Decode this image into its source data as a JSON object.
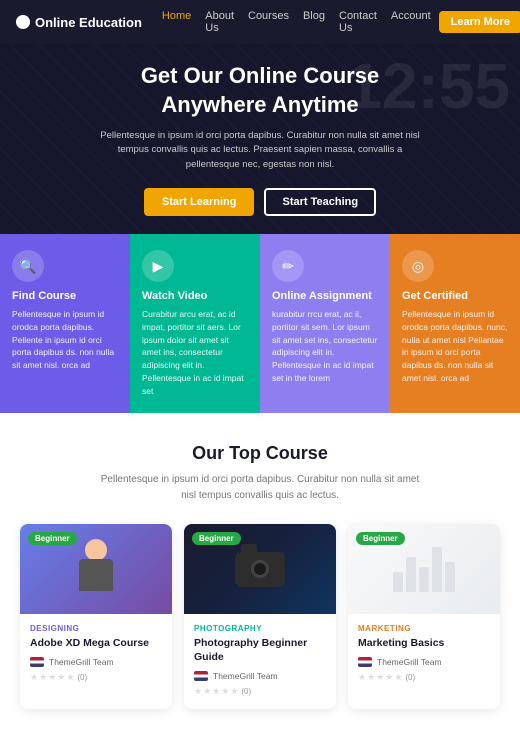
{
  "brand": {
    "name": "Online Education"
  },
  "nav": {
    "links": [
      {
        "label": "Home",
        "active": true
      },
      {
        "label": "About Us",
        "active": false
      },
      {
        "label": "Courses",
        "active": false
      },
      {
        "label": "Blog",
        "active": false
      },
      {
        "label": "Contact Us",
        "active": false
      },
      {
        "label": "Account",
        "active": false
      }
    ],
    "cta": "Learn More",
    "search_icon": "🔍"
  },
  "hero": {
    "bg_number": "12:55",
    "heading_line1": "Get Our Online Course",
    "heading_line2": "Anywhere Anytime",
    "description": "Pellentesque in ipsum id orci porta dapibus. Curabitur non nulla sit amet nisl tempus convallis quis ac lectus. Praesent sapien massa, convallis a pellentesque nec, egestas non nisl.",
    "btn_primary": "Start Learning",
    "btn_secondary": "Start Teaching"
  },
  "features": [
    {
      "icon": "🔍",
      "title": "Find Course",
      "desc": "Pellentesque in ipsum id orodca porta dapibus. Pellente in ipsum id orci porta dapibus ds. non nulla sit amet nisl. orca ad"
    },
    {
      "icon": "▶",
      "title": "Watch Video",
      "desc": "Curabitur arcu erat, ac id impat, portitor sit aers. Lor ipsum dolor sit amet sit amet ins, consectetur adipiscing elit in. Pellentesque in ac id impat set"
    },
    {
      "icon": "✏",
      "title": "Online Assignment",
      "desc": "kurabitur rrcu erat, ac ii, portitor sit sem. Lor ipsum sit amet set ins, consectetur adipiscing elit in. Pellentesque in ac id impat set in the lorem"
    },
    {
      "icon": "◯",
      "title": "Get Certified",
      "desc": "Pellentesque in ipsum id orodca porta dapibus. nunc, nulla ut amet nisl Pellantae in ipsum id orci porta dapibus ds. non nulla sit amet nisl. orca ad"
    }
  ],
  "courses_section": {
    "title": "Our Top Course",
    "description": "Pellentesque in ipsum id orci porta dapibus. Curabitur non nulla sit amet nisl tempus convallis quis ac lectus."
  },
  "courses": [
    {
      "badge": "Beginner",
      "category": "DESIGNING",
      "name": "Adobe XD Mega Course",
      "author": "ThemeGrill Team",
      "rating": 0,
      "rating_count": "(0)",
      "thumb_type": "design"
    },
    {
      "badge": "Beginner",
      "category": "PHOTOGRAPHY",
      "name": "Photography Beginner Guide",
      "author": "ThemeGrill Team",
      "rating": 0,
      "rating_count": "(0)",
      "thumb_type": "photo"
    },
    {
      "badge": "Beginner",
      "category": "MARKETING",
      "name": "Marketing Basics",
      "author": "ThemeGrill Team",
      "rating": 0,
      "rating_count": "(0)",
      "thumb_type": "marketing"
    }
  ]
}
